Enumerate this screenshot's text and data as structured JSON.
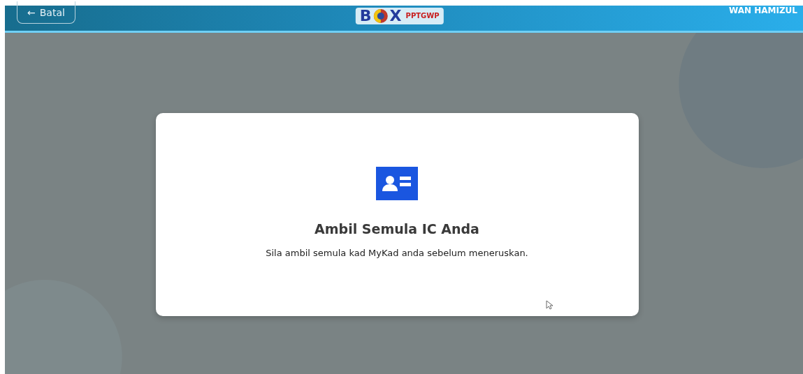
{
  "header": {
    "back_button": {
      "icon": "←",
      "label": "Batal"
    },
    "logo": {
      "letter_left": "B",
      "letter_right": "X",
      "brand": "PPTGWP"
    },
    "user_name": "WAN HAMIZUL"
  },
  "dialog": {
    "title": "Ambil Semula IC Anda",
    "message": "Sila ambil semula kad MyKad anda sebelum meneruskan."
  }
}
